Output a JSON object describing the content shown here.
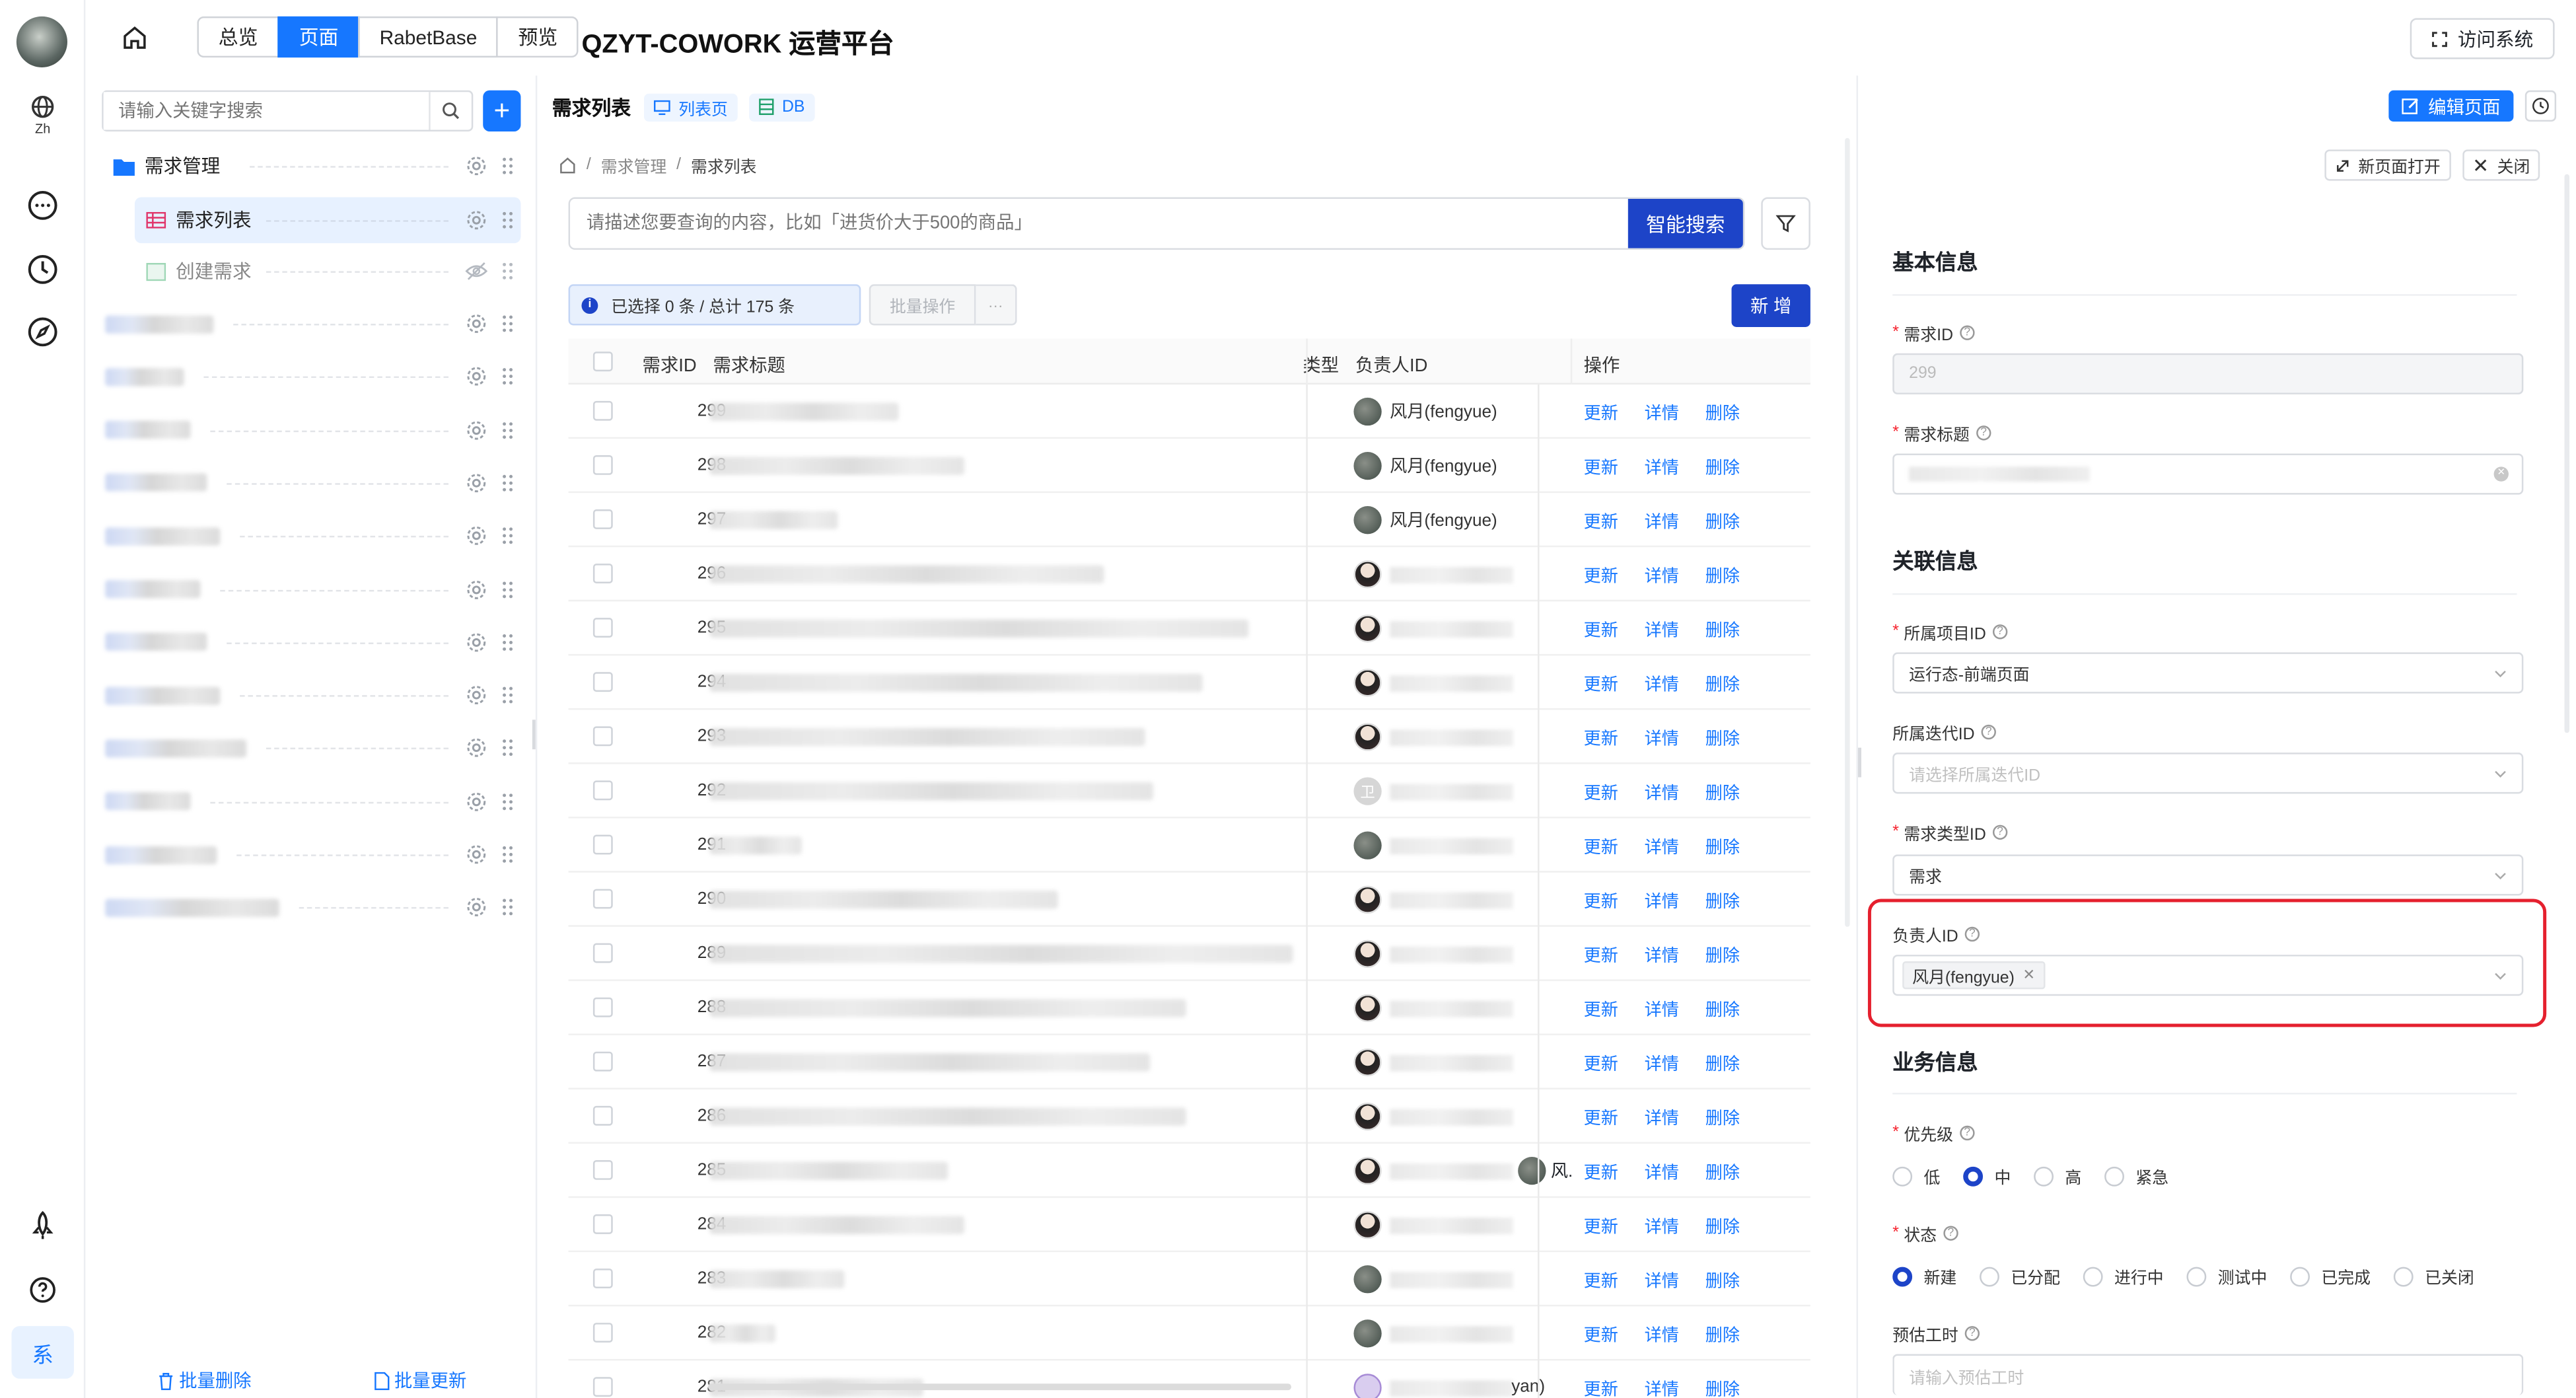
{
  "rail": {
    "lang_label": "Zh",
    "bottom_label": "系"
  },
  "topbar": {
    "tabs": [
      {
        "label": "总览"
      },
      {
        "label": "页面"
      },
      {
        "label": "RabetBase"
      },
      {
        "label": "预览"
      }
    ],
    "active_tab": "页面",
    "title": "QZYT-COWORK 运营平台",
    "visit_label": "访问系统"
  },
  "sidebar": {
    "search_placeholder": "请输入关键字搜索",
    "tree": [
      {
        "label": "需求管理",
        "type": "folder"
      },
      {
        "label": "需求列表",
        "type": "page",
        "selected": true
      },
      {
        "label": "创建需求",
        "type": "page",
        "hidden": true
      }
    ],
    "batch_delete": "批量删除",
    "batch_update": "批量更新"
  },
  "page_header": {
    "title": "需求列表",
    "tag_list": "列表页",
    "tag_db": "DB",
    "edit_label": "编辑页面"
  },
  "breadcrumb": {
    "items": [
      "需求管理",
      "需求列表"
    ]
  },
  "search": {
    "placeholder": "请描述您要查询的内容，比如「进货价大于500的商品」",
    "button": "智能搜索"
  },
  "selection": {
    "text": "已选择 0 条 / 总计 175 条",
    "batch_label": "批量操作",
    "more": "···",
    "new_label": "新 增"
  },
  "table": {
    "columns": {
      "id": "需求ID",
      "title": "需求标题",
      "type": "类型",
      "owner": "负责人ID",
      "ops": "操作"
    },
    "op_labels": {
      "update": "更新",
      "detail": "详情",
      "delete": "删除"
    },
    "rows": [
      {
        "id": "299",
        "owner": "风月(fengyue)"
      },
      {
        "id": "298",
        "owner": "风月(fengyue)"
      },
      {
        "id": "297",
        "owner": "风月(fengyue)"
      },
      {
        "id": "296",
        "owner": ""
      },
      {
        "id": "295",
        "owner": ""
      },
      {
        "id": "294",
        "owner": ""
      },
      {
        "id": "293",
        "owner": ""
      },
      {
        "id": "292",
        "owner": ""
      },
      {
        "id": "291",
        "owner": ""
      },
      {
        "id": "290",
        "owner": ""
      },
      {
        "id": "289",
        "owner": ""
      },
      {
        "id": "288",
        "owner": ""
      },
      {
        "id": "287",
        "owner": ""
      },
      {
        "id": "286",
        "owner": ""
      },
      {
        "id": "285",
        "owner": ""
      },
      {
        "id": "284",
        "owner": ""
      },
      {
        "id": "283",
        "owner": ""
      },
      {
        "id": "282",
        "owner": ""
      },
      {
        "id": "281",
        "owner": ""
      }
    ],
    "avatar_letter": "卫",
    "overlap_text": "风.",
    "tail_text": "yan)"
  },
  "detail": {
    "open_new": "新页面打开",
    "close": "关闭",
    "sections": {
      "basic": "基本信息",
      "relation": "关联信息",
      "business": "业务信息"
    },
    "fields": {
      "req_id": {
        "label": "需求ID",
        "value": "299"
      },
      "req_title": {
        "label": "需求标题"
      },
      "project": {
        "label": "所属项目ID",
        "value": "运行态-前端页面"
      },
      "iteration": {
        "label": "所属迭代ID",
        "placeholder": "请选择所属迭代ID"
      },
      "req_type": {
        "label": "需求类型ID",
        "value": "需求"
      },
      "owner": {
        "label": "负责人ID",
        "tag": "风月(fengyue)"
      },
      "priority": {
        "label": "优先级",
        "options": [
          "低",
          "中",
          "高",
          "紧急"
        ],
        "selected": "中"
      },
      "status": {
        "label": "状态",
        "options": [
          "新建",
          "已分配",
          "进行中",
          "测试中",
          "已完成",
          "已关闭"
        ],
        "selected": "新建"
      },
      "estimate": {
        "label": "预估工时",
        "placeholder": "请输入预估工时"
      }
    }
  },
  "colors": {
    "primary": "#1677ff",
    "navy": "#1d44c8",
    "highlight": "#e5202e"
  }
}
